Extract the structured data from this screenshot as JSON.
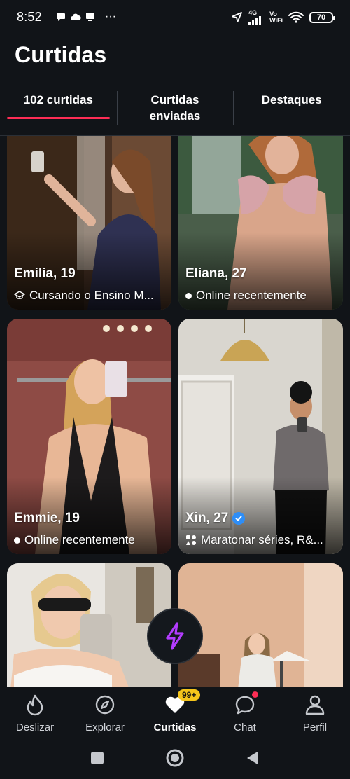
{
  "status_bar": {
    "time": "8:52",
    "net_label_top": "4G",
    "volte_label_top": "Vo",
    "volte_label_bottom": "WiFi",
    "battery": "70",
    "more": "···"
  },
  "header": {
    "title": "Curtidas"
  },
  "tabs": [
    {
      "label": "102 curtidas",
      "active": true
    },
    {
      "label": "Curtidas\nenviadas",
      "active": false
    },
    {
      "label": "Destaques",
      "active": false
    }
  ],
  "cards": [
    {
      "name": "Emilia, 19",
      "subtitle": "Cursando o Ensino M...",
      "sub_icon": "graduation-cap-icon",
      "verified": false
    },
    {
      "name": "Eliana, 27",
      "subtitle": "Online recentemente",
      "sub_icon": "online-dot",
      "verified": false
    },
    {
      "name": "Emmie, 19",
      "subtitle": "Online recentemente",
      "sub_icon": "online-dot",
      "verified": false
    },
    {
      "name": "Xin, 27",
      "subtitle": "Maratonar séries, R&...",
      "sub_icon": "interests-icon",
      "verified": true
    },
    {
      "name": "",
      "subtitle": "",
      "sub_icon": "",
      "verified": false
    },
    {
      "name": "",
      "subtitle": "",
      "sub_icon": "",
      "verified": false
    }
  ],
  "bottom_nav": [
    {
      "label": "Deslizar",
      "icon": "flame-icon",
      "active": false
    },
    {
      "label": "Explorar",
      "icon": "compass-icon",
      "active": false
    },
    {
      "label": "Curtidas",
      "icon": "heart-icon",
      "active": true,
      "badge": "99+"
    },
    {
      "label": "Chat",
      "icon": "chat-icon",
      "active": false,
      "dot": true
    },
    {
      "label": "Perfil",
      "icon": "profile-icon",
      "active": false
    }
  ],
  "colors": {
    "background": "#111418",
    "accent": "#fd2d55",
    "badge": "#f5c51b",
    "boost": "#b33cff",
    "verified": "#2e8ef7"
  }
}
